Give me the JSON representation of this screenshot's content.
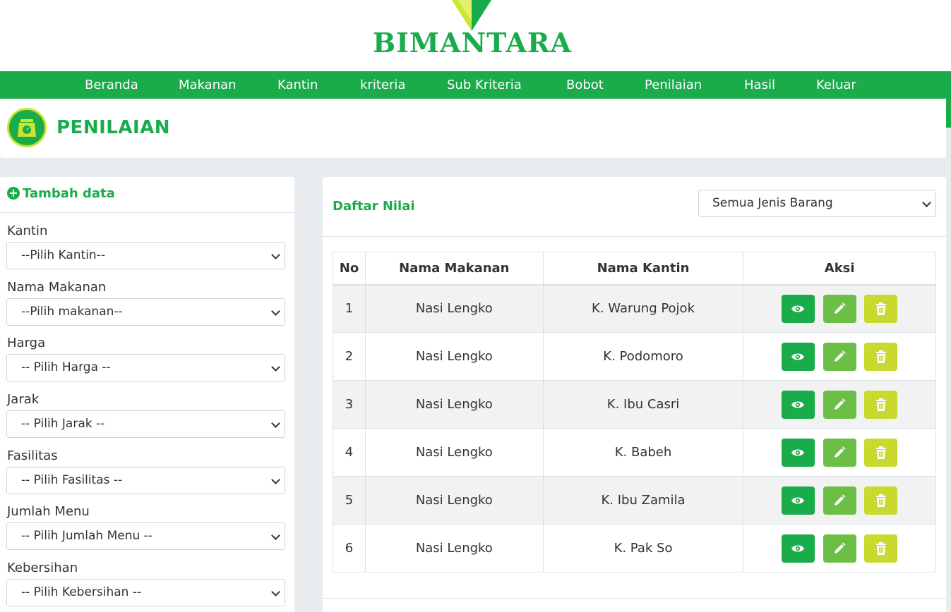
{
  "brand": {
    "name": "BIMANTARA"
  },
  "nav": [
    {
      "label": "Beranda"
    },
    {
      "label": "Makanan"
    },
    {
      "label": "Kantin"
    },
    {
      "label": "kriteria"
    },
    {
      "label": "Sub Kriteria"
    },
    {
      "label": "Bobot"
    },
    {
      "label": "Penilaian"
    },
    {
      "label": "Hasil"
    },
    {
      "label": "Keluar"
    }
  ],
  "header": {
    "title": "PENILAIAN",
    "icon": "scale-icon"
  },
  "form": {
    "title": "Tambah data",
    "fields": [
      {
        "label": "Kantin",
        "value": "--Pilih Kantin--"
      },
      {
        "label": "Nama Makanan",
        "value": "--Pilih makanan--"
      },
      {
        "label": "Harga",
        "value": "-- Pilih Harga --"
      },
      {
        "label": "Jarak",
        "value": "-- Pilih Jarak --"
      },
      {
        "label": "Fasilitas",
        "value": "-- Pilih Fasilitas --"
      },
      {
        "label": "Jumlah Menu",
        "value": "-- Pilih Jumlah Menu --"
      },
      {
        "label": "Kebersihan",
        "value": "-- Pilih Kebersihan --"
      }
    ]
  },
  "list": {
    "title": "Daftar Nilai",
    "filter": "Semua Jenis Barang",
    "columns": [
      "No",
      "Nama Makanan",
      "Nama Kantin",
      "Aksi"
    ],
    "rows": [
      {
        "no": "1",
        "makanan": "Nasi Lengko",
        "kantin": "K. Warung Pojok"
      },
      {
        "no": "2",
        "makanan": "Nasi Lengko",
        "kantin": "K. Podomoro"
      },
      {
        "no": "3",
        "makanan": "Nasi Lengko",
        "kantin": "K. Ibu Casri"
      },
      {
        "no": "4",
        "makanan": "Nasi Lengko",
        "kantin": "K. Babeh"
      },
      {
        "no": "5",
        "makanan": "Nasi Lengko",
        "kantin": "K. Ibu Zamila"
      },
      {
        "no": "6",
        "makanan": "Nasi Lengko",
        "kantin": "K. Pak So"
      }
    ]
  },
  "colors": {
    "primary": "#1aab4b",
    "edit": "#6cbf45",
    "delete": "#c9d92e",
    "accent": "#c9e52d"
  }
}
